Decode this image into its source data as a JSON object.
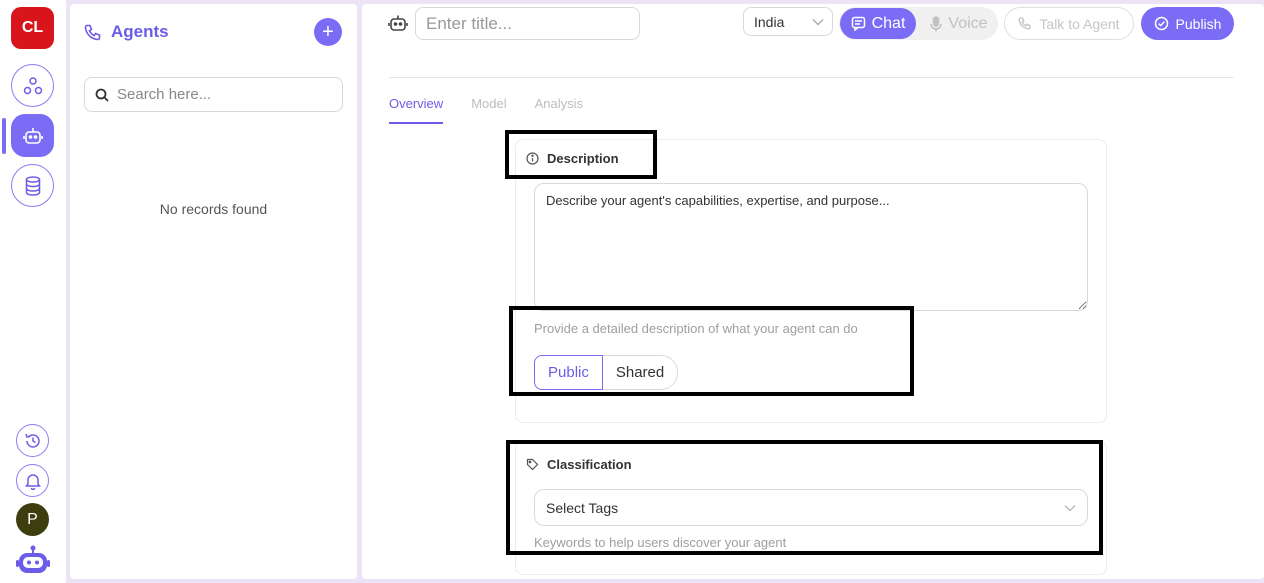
{
  "rail": {
    "logo_text": "CL",
    "avatar_initial": "P",
    "items": [
      {
        "name": "workflows-icon"
      },
      {
        "name": "agents-icon",
        "active": true
      },
      {
        "name": "database-icon"
      }
    ]
  },
  "agents_panel": {
    "title": "Agents",
    "add_label": "+",
    "search_placeholder": "Search here...",
    "empty_text": "No records found"
  },
  "header": {
    "title_placeholder": "Enter title...",
    "country": "India",
    "modes": [
      {
        "label": "Chat",
        "active": true
      },
      {
        "label": "Voice",
        "active": false
      }
    ],
    "talk_label": "Talk to Agent",
    "publish_label": "Publish"
  },
  "tabs": [
    {
      "label": "Overview",
      "active": true
    },
    {
      "label": "Model",
      "active": false
    },
    {
      "label": "Analysis",
      "active": false
    }
  ],
  "description": {
    "heading": "Description",
    "value": "Describe your agent's capabilities, expertise, and purpose...",
    "hint": "Provide a detailed description of what your agent can do",
    "visibility": {
      "options": [
        "Public",
        "Shared"
      ],
      "selected": "Public"
    }
  },
  "classification": {
    "heading": "Classification",
    "tags_placeholder": "Select Tags",
    "hint": "Keywords to help users discover your agent"
  },
  "colors": {
    "accent": "#7b6cf6",
    "logo_bg": "#d7151a",
    "highlight_border": "#000000"
  }
}
